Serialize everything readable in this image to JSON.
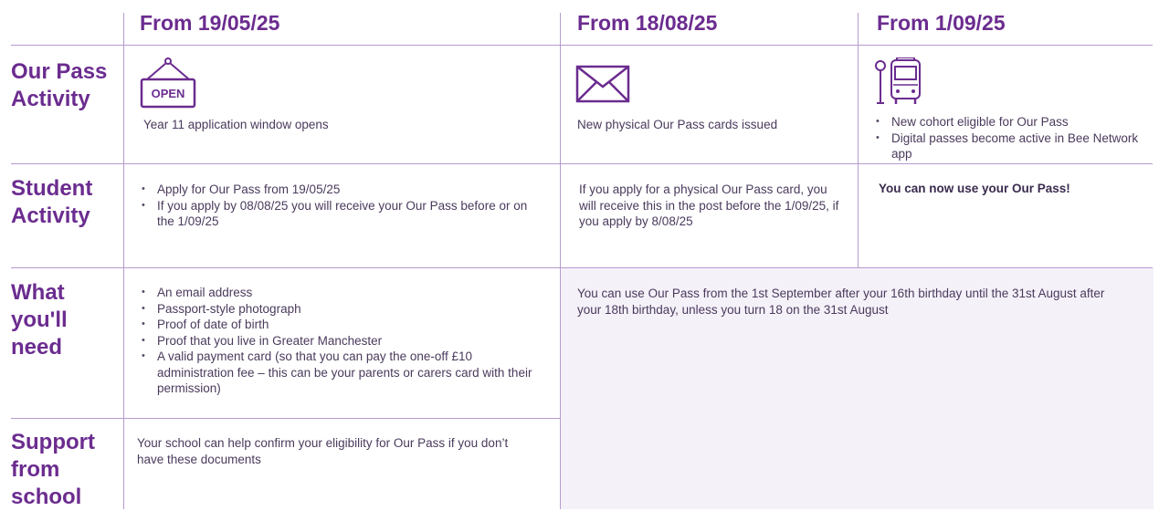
{
  "headers": [
    "From 19/05/25",
    "From 18/08/25",
    "From 1/09/25"
  ],
  "rows": {
    "pass_activity": {
      "label": "Our Pass Activity",
      "col1_text": "Year 11 application window opens",
      "col2_text": "New physical Our Pass cards issued",
      "col3_items": [
        "New cohort eligible for Our Pass",
        "Digital passes become active in Bee Network app"
      ],
      "open_sign_text": "OPEN"
    },
    "student_activity": {
      "label": "Student Activity",
      "col1_items": [
        "Apply for Our Pass from 19/05/25",
        "If you apply by 08/08/25 you will receive your Our Pass before or on the 1/09/25"
      ],
      "col2_text": "If you apply for a physical Our Pass card, you will receive this in the post before the 1/09/25, if you apply by 8/08/25",
      "col3_text": "You can now use your Our Pass!"
    },
    "what_you_need": {
      "label": "What you'll need",
      "col1_items": [
        "An email address",
        "Passport-style photograph",
        "Proof of date of birth",
        "Proof that you live in Greater Manchester",
        "A valid payment card (so that you can pay the one-off £10 administration fee – this can be your parents or carers card with their permission)"
      ],
      "merged_text": "You can use Our Pass from the 1st September after your 16th birthday until the 31st August after your 18th birthday, unless you turn 18 on the 31st August"
    },
    "support": {
      "label": "Support from school",
      "col1_text": "Your school can help confirm your eligibility for Our Pass if you don’t have these documents"
    }
  },
  "colors": {
    "accent": "#6b2c8f",
    "line": "#b79bcf",
    "text": "#4a3a5c",
    "shade": "#f5f1f9"
  },
  "icons": [
    "open-sign-icon",
    "envelope-icon",
    "bus-stop-icon"
  ]
}
